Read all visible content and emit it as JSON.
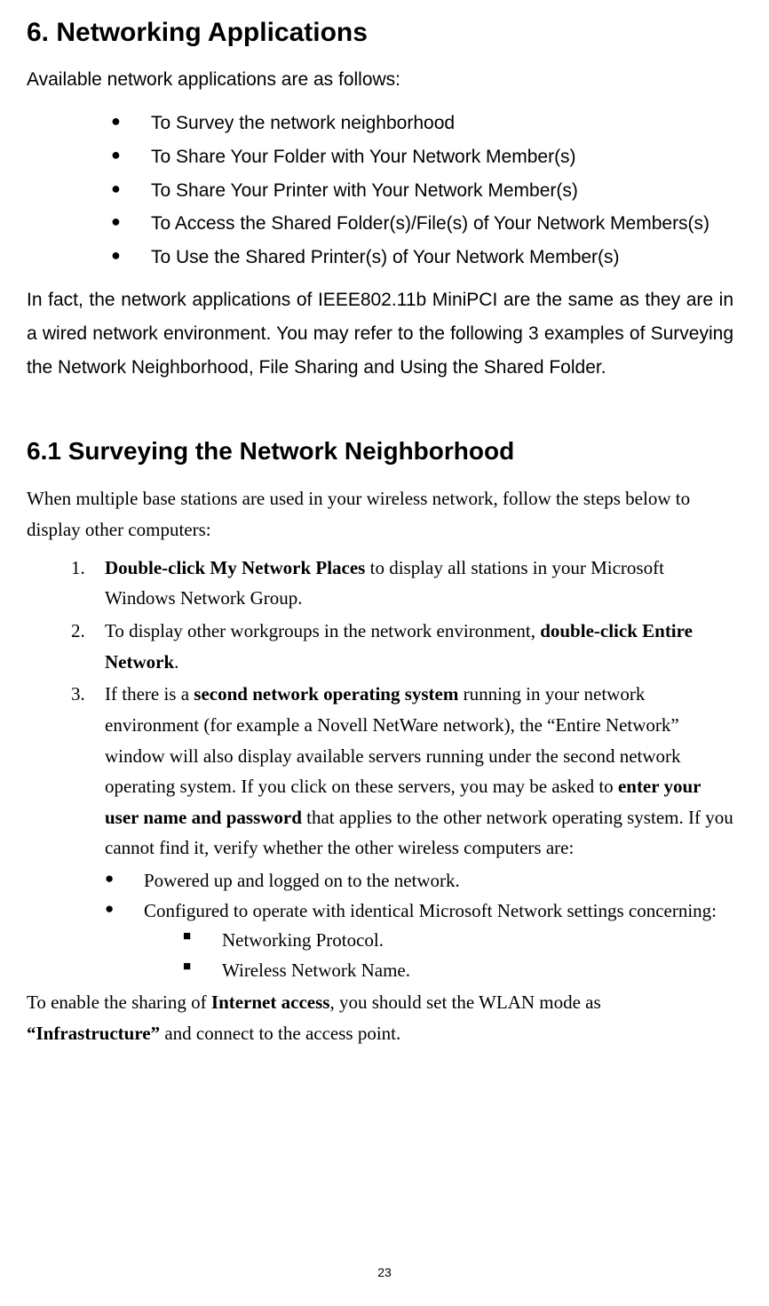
{
  "heading1": "6. Networking Applications",
  "intro": "Available network applications are as follows:",
  "bullets": [
    "To Survey the network neighborhood",
    "To Share Your Folder with Your Network Member(s)",
    "To Share Your Printer with Your Network Member(s)",
    "To Access the Shared Folder(s)/File(s) of Your Network Members(s)",
    "To Use the Shared Printer(s) of Your Network Member(s)"
  ],
  "paragraph": "In fact, the network applications of IEEE802.11b MiniPCI are the same as they are in a wired network environment.  You may refer to the following 3 examples of Surveying the Network Neighborhood, File Sharing and Using the Shared Folder.",
  "heading2": "6.1  Surveying the Network Neighborhood",
  "subintro": "When multiple base stations are used in your wireless network, follow the steps below to display other computers:",
  "item1_bold": "Double-click My Network Places",
  "item1_rest": " to display all stations in your Microsoft Windows Network Group.",
  "item2_pre": "To display other workgroups in the network environment, ",
  "item2_bold": "double-click Entire Network",
  "item2_post": ".",
  "item3_pre": "If there is a ",
  "item3_bold1": "second network operating system",
  "item3_mid": " running in your network environment (for example a Novell NetWare network), the “Entire Network” window will also display available servers running under the second network operating system. If you click on these servers, you may be asked to ",
  "item3_bold2": "enter your user name and password",
  "item3_post": " that applies to the other network operating system. If you cannot find it, verify whether the other wireless computers are:",
  "inner1": "Powered up and logged on to the network.",
  "inner2": "Configured to operate with identical Microsoft Network settings concerning:",
  "square1": "Networking Protocol.",
  "square2": "Wireless Network Name.",
  "closing_pre": "To enable the sharing of ",
  "closing_bold1": "Internet access",
  "closing_mid": ", you should set the WLAN mode as ",
  "closing_bold2": "“Infrastructure”",
  "closing_post": " and connect to the access point.",
  "page_number": "23"
}
